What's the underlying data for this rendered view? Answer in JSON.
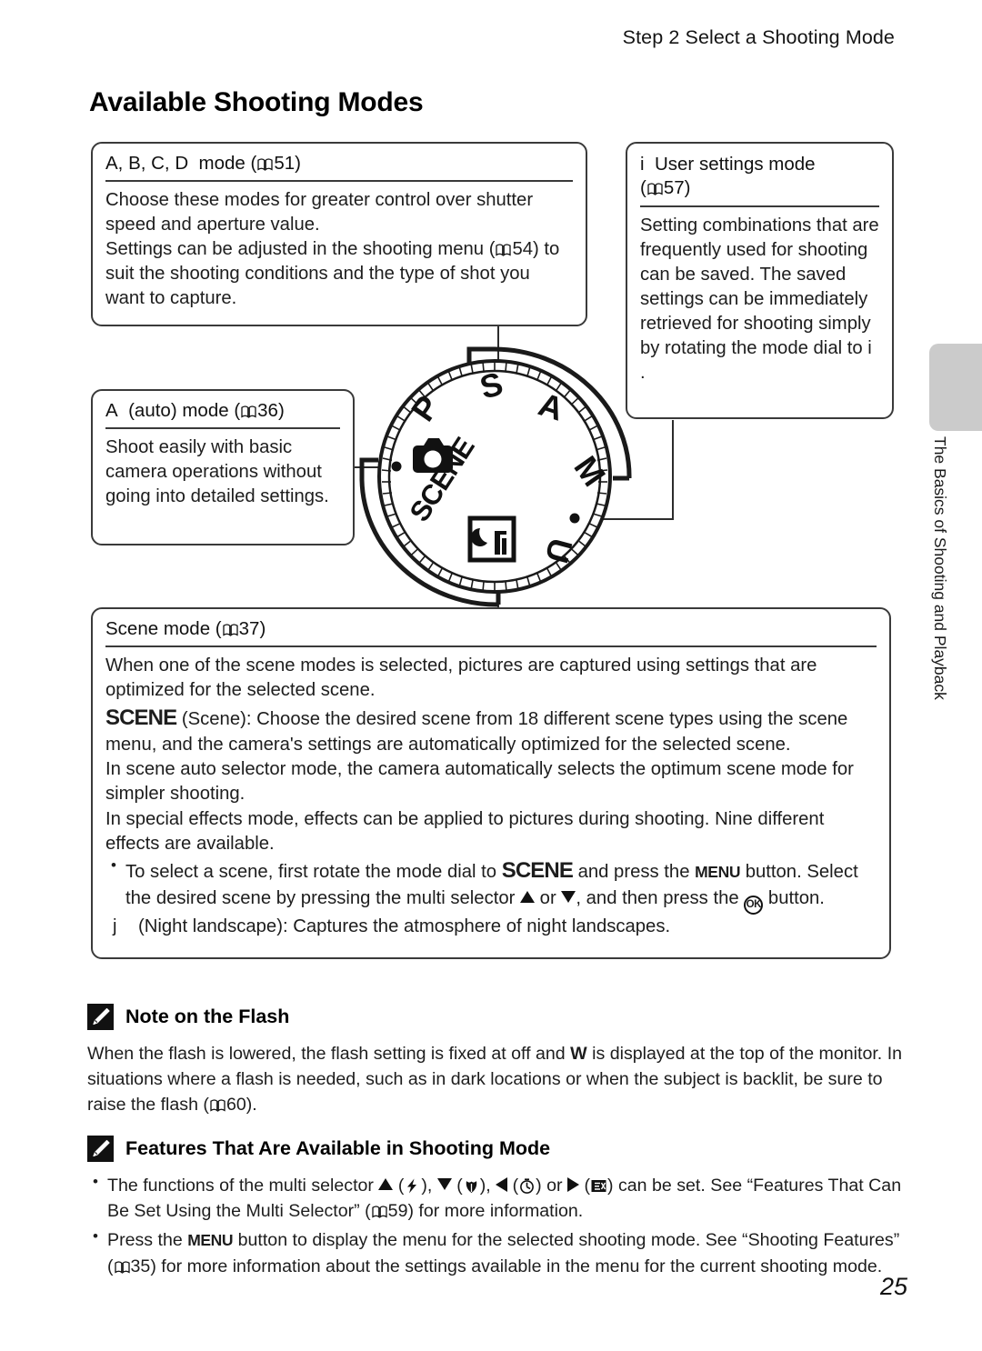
{
  "header": {
    "running_head": "Step 2 Select a Shooting Mode",
    "page_title": "Available Shooting Modes"
  },
  "side_tab": {
    "label": "The Basics of Shooting and Playback",
    "color": "#cbcbcb"
  },
  "page_number": "25",
  "boxes": {
    "advanced": {
      "heading_modes": "A, B, C, D",
      "heading_label": "mode (",
      "heading_page": "51",
      "heading_close": ")",
      "line1": "Choose these modes for greater control over shutter speed and aperture value.",
      "line2a": "Settings can be adjusted in the shooting menu (",
      "line2_page": "54",
      "line2b": ") to suit the shooting conditions and the type of shot you want to capture."
    },
    "user": {
      "heading_icon": "i",
      "heading_label": "User settings mode",
      "heading_open": "(",
      "heading_page": "57",
      "heading_close": ")",
      "body": "Setting combinations that are frequently used for shooting can be saved. The saved settings can be immediately retrieved for shooting simply by rotating the mode dial to",
      "body_tail_icon": "i",
      "body_tail": "."
    },
    "auto": {
      "heading_icon": "A",
      "heading_label": "(auto) mode (",
      "heading_page": "36",
      "heading_close": ")",
      "body": "Shoot easily with basic camera operations without going into detailed settings."
    },
    "scene": {
      "heading_label": "Scene mode (",
      "heading_page": "37",
      "heading_close": ")",
      "para1": "When one of the scene modes is selected, pictures are captured using settings that are optimized for the selected scene.",
      "para2_mark": "SCENE",
      "para2": "(Scene): Choose the desired scene from 18 different scene types using the scene menu, and the camera's settings are automatically optimized for the selected scene.",
      "para3": "In scene auto selector mode, the camera automatically selects the optimum scene mode for simpler shooting.",
      "para4": "In special effects mode, effects can be applied to pictures during shooting. Nine different effects are available.",
      "bullet1a": "To select a scene, first rotate the mode dial to",
      "bullet1_scene": "SCENE",
      "bullet1b": "and press the",
      "bullet1_menu": "MENU",
      "bullet1c": "button. Select the desired scene by pressing the multi selector",
      "bullet1_or": "or",
      "bullet1d": ", and then press the",
      "bullet1_ok": "OK",
      "bullet1e": "button.",
      "night_mark": "j",
      "night_text": "(Night landscape): Captures the atmosphere of night landscapes."
    }
  },
  "dial": {
    "labels": [
      "P",
      "S",
      "A",
      "M",
      "U",
      "SCENE"
    ],
    "icons": [
      "camera-auto-icon",
      "night-landscape-icon"
    ]
  },
  "notes": {
    "flash": {
      "icon": "pencil-note-icon",
      "title": "Note on the Flash",
      "line1a": "When the flash is lowered, the flash setting is fixed at off and",
      "line1_glyph": "W",
      "line1b": "is displayed at the top of the monitor. In situations where a flash is needed, such as in dark locations or when the subject is backlit, be sure to raise the flash (",
      "line1_page": "60",
      "line1c": ")."
    },
    "features": {
      "icon": "pencil-note-icon",
      "title": "Features That Are Available in Shooting Mode",
      "bullet1a": "The functions of the multi selector",
      "bullet1b": "can be set. See “Features That Can Be Set Using the Multi Selector” (",
      "bullet1_page": "59",
      "bullet1c": ") for more information.",
      "bullet2a": "Press the",
      "bullet2_menu": "MENU",
      "bullet2b": "button to display the menu for the selected shooting mode. See “Shooting Features” (",
      "bullet2_page": "35",
      "bullet2c": ") for more information about the settings available in the menu for the current shooting mode."
    }
  }
}
